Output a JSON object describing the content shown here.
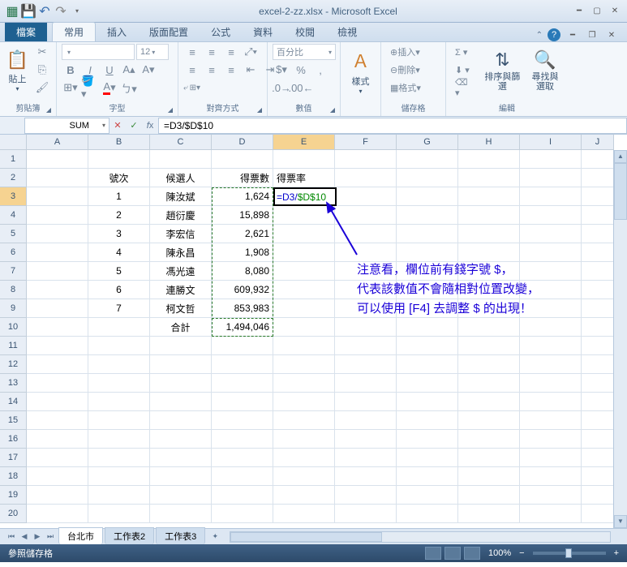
{
  "title": "excel-2-zz.xlsx - Microsoft Excel",
  "tabs": {
    "file": "檔案",
    "home": "常用",
    "insert": "插入",
    "layout": "版面配置",
    "formula": "公式",
    "data": "資料",
    "review": "校閱",
    "view": "檢視"
  },
  "ribbon": {
    "paste": "貼上",
    "clipboard": "剪貼簿",
    "font_group": "字型",
    "font_size": "12",
    "align_group": "對齊方式",
    "percent_label": "百分比",
    "number_group": "數值",
    "styles": "樣式",
    "insert_btn": "插入",
    "delete_btn": "刪除",
    "format_btn": "格式",
    "cells_group": "儲存格",
    "sort_filter": "排序與篩選",
    "find_select": "尋找與\n選取",
    "editing_group": "編輯"
  },
  "name_box": "SUM",
  "formula": "=D3/$D$10",
  "columns": [
    "A",
    "B",
    "C",
    "D",
    "E",
    "F",
    "G",
    "H",
    "I",
    "J"
  ],
  "row_count": 20,
  "selected_row": 3,
  "selected_col": "E",
  "headers": {
    "B": "號次",
    "C": "候選人",
    "D": "得票數",
    "E": "得票率"
  },
  "rows": [
    {
      "B": "1",
      "C": "陳汝斌",
      "D": "1,624"
    },
    {
      "B": "2",
      "C": "趙衍慶",
      "D": "15,898"
    },
    {
      "B": "3",
      "C": "李宏信",
      "D": "2,621"
    },
    {
      "B": "4",
      "C": "陳永昌",
      "D": "1,908"
    },
    {
      "B": "5",
      "C": "馮光遠",
      "D": "8,080"
    },
    {
      "B": "6",
      "C": "連勝文",
      "D": "609,932"
    },
    {
      "B": "7",
      "C": "柯文哲",
      "D": "853,983"
    },
    {
      "B": "",
      "C": "合計",
      "D": "1,494,046"
    }
  ],
  "active_cell": {
    "part1": "=D3/",
    "part2": "$D$10"
  },
  "annotation": {
    "line1": "注意看，欄位前有錢字號 $，",
    "line2": "代表該數值不會隨相對位置改變，",
    "line3": "可以使用 [F4] 去調整 $ 的出現！"
  },
  "sheets": {
    "s1": "台北市",
    "s2": "工作表2",
    "s3": "工作表3"
  },
  "status": "參照儲存格",
  "zoom": "100%",
  "zoom_minus": "−",
  "zoom_plus": "+",
  "chart_data": {
    "type": "table",
    "title": "得票數 / 得票率",
    "columns": [
      "號次",
      "候選人",
      "得票數"
    ],
    "rows": [
      [
        1,
        "陳汝斌",
        1624
      ],
      [
        2,
        "趙衍慶",
        15898
      ],
      [
        3,
        "李宏信",
        2621
      ],
      [
        4,
        "陳永昌",
        1908
      ],
      [
        5,
        "馮光遠",
        8080
      ],
      [
        6,
        "連勝文",
        609932
      ],
      [
        7,
        "柯文哲",
        853983
      ]
    ],
    "total": 1494046,
    "formula_shown": "=D3/$D$10"
  }
}
